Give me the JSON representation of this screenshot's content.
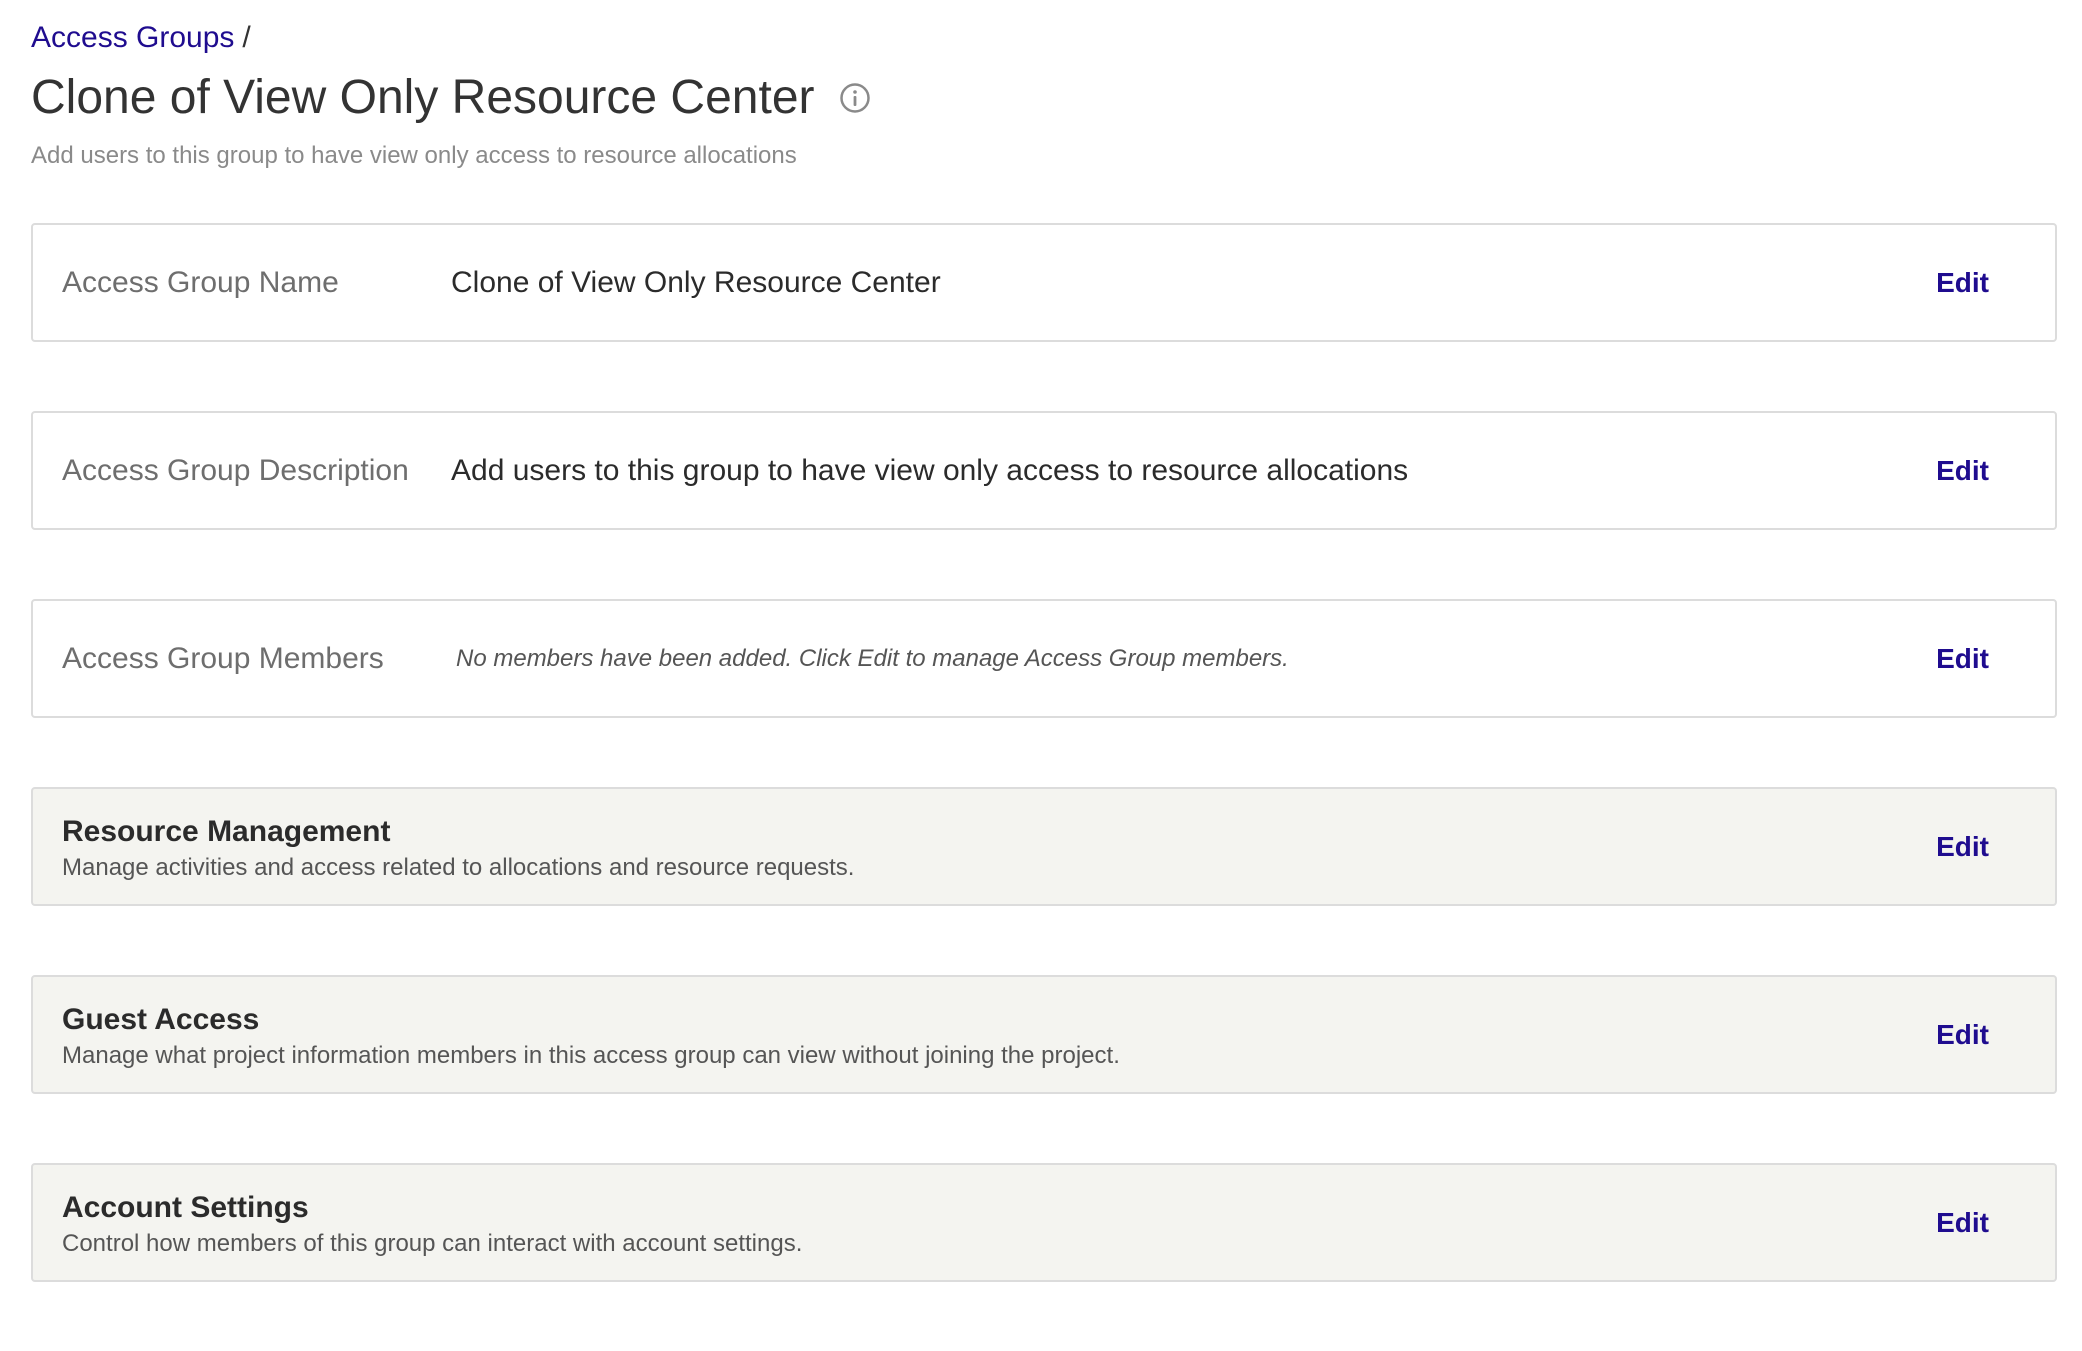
{
  "breadcrumb": {
    "parent_label": "Access Groups",
    "separator": "/"
  },
  "header": {
    "title": "Clone of View Only Resource Center",
    "info_icon": "info-circle-icon",
    "subtitle": "Add users to this group to have view only access to resource allocations"
  },
  "fields": [
    {
      "label": "Access Group Name",
      "value": "Clone of View Only Resource Center",
      "edit_label": "Edit"
    },
    {
      "label": "Access Group Description",
      "value": "Add users to this group to have view only access to resource allocations",
      "edit_label": "Edit"
    },
    {
      "label": "Access Group Members",
      "value": "No members have been added. Click Edit to manage Access Group members.",
      "edit_label": "Edit"
    }
  ],
  "sections": [
    {
      "title": "Resource Management",
      "description": "Manage activities and access related to allocations and resource requests.",
      "edit_label": "Edit"
    },
    {
      "title": "Guest Access",
      "description": "Manage what project information members in this access group can view without joining the project.",
      "edit_label": "Edit"
    },
    {
      "title": "Account Settings",
      "description": "Control how members of this group can interact with account settings.",
      "edit_label": "Edit"
    }
  ],
  "colors": {
    "link": "#1f0c8f",
    "section_bg": "#f4f4f0",
    "border": "#dcdcdc"
  }
}
